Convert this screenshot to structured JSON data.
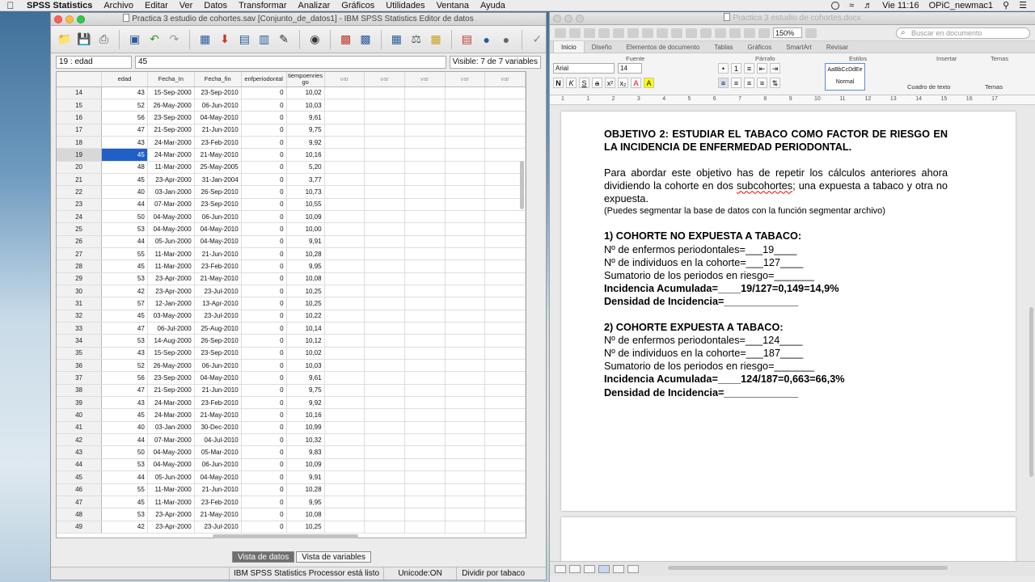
{
  "menubar": {
    "app": "SPSS Statistics",
    "items": [
      "Archivo",
      "Editar",
      "Ver",
      "Datos",
      "Transformar",
      "Analizar",
      "Gráficos",
      "Utilidades",
      "Ventana",
      "Ayuda"
    ],
    "clock": "Vie 11:16",
    "user": "OPiC_newmac1"
  },
  "spss": {
    "title": "Practica 3 estudio de cohortes.sav [Conjunto_de_datos1] - IBM SPSS Statistics Editor de datos",
    "cell_ref": "19 : edad",
    "cell_value": "45",
    "visible": "Visible: 7 de 7 variables",
    "columns": [
      "edad",
      "Fecha_In",
      "Fecha_fin",
      "enfperiodontal",
      "tiempoenries go",
      "var",
      "var",
      "var",
      "var",
      "var"
    ],
    "rows": [
      [
        "14",
        "43",
        "15-Sep-2000",
        "23-Sep-2010",
        "0",
        "10,02"
      ],
      [
        "15",
        "52",
        "26-May-2000",
        "06-Jun-2010",
        "0",
        "10,03"
      ],
      [
        "16",
        "56",
        "23-Sep-2000",
        "04-May-2010",
        "0",
        "9,61"
      ],
      [
        "17",
        "47",
        "21-Sep-2000",
        "21-Jun-2010",
        "0",
        "9,75"
      ],
      [
        "18",
        "43",
        "24-Mar-2000",
        "23-Feb-2010",
        "0",
        "9,92"
      ],
      [
        "19",
        "45",
        "24-Mar-2000",
        "21-May-2010",
        "0",
        "10,16"
      ],
      [
        "20",
        "48",
        "11-Mar-2000",
        "25-May-2005",
        "0",
        "5,20"
      ],
      [
        "21",
        "45",
        "23-Apr-2000",
        "31-Jan-2004",
        "0",
        "3,77"
      ],
      [
        "22",
        "40",
        "03-Jan-2000",
        "26-Sep-2010",
        "0",
        "10,73"
      ],
      [
        "23",
        "44",
        "07-Mar-2000",
        "23-Sep-2010",
        "0",
        "10,55"
      ],
      [
        "24",
        "50",
        "04-May-2000",
        "06-Jun-2010",
        "0",
        "10,09"
      ],
      [
        "25",
        "53",
        "04-May-2000",
        "04-May-2010",
        "0",
        "10,00"
      ],
      [
        "26",
        "44",
        "05-Jun-2000",
        "04-May-2010",
        "0",
        "9,91"
      ],
      [
        "27",
        "55",
        "11-Mar-2000",
        "21-Jun-2010",
        "0",
        "10,28"
      ],
      [
        "28",
        "45",
        "11-Mar-2000",
        "23-Feb-2010",
        "0",
        "9,95"
      ],
      [
        "29",
        "53",
        "23-Apr-2000",
        "21-May-2010",
        "0",
        "10,08"
      ],
      [
        "30",
        "42",
        "23-Apr-2000",
        "23-Jul-2010",
        "0",
        "10,25"
      ],
      [
        "31",
        "57",
        "12-Jan-2000",
        "13-Apr-2010",
        "0",
        "10,25"
      ],
      [
        "32",
        "45",
        "03-May-2000",
        "23-Jul-2010",
        "0",
        "10,22"
      ],
      [
        "33",
        "47",
        "06-Jul-2000",
        "25-Aug-2010",
        "0",
        "10,14"
      ],
      [
        "34",
        "53",
        "14-Aug-2000",
        "26-Sep-2010",
        "0",
        "10,12"
      ],
      [
        "35",
        "43",
        "15-Sep-2000",
        "23-Sep-2010",
        "0",
        "10,02"
      ],
      [
        "36",
        "52",
        "26-May-2000",
        "06-Jun-2010",
        "0",
        "10,03"
      ],
      [
        "37",
        "56",
        "23-Sep-2000",
        "04-May-2010",
        "0",
        "9,61"
      ],
      [
        "38",
        "47",
        "21-Sep-2000",
        "21-Jun-2010",
        "0",
        "9,75"
      ],
      [
        "39",
        "43",
        "24-Mar-2000",
        "23-Feb-2010",
        "0",
        "9,92"
      ],
      [
        "40",
        "45",
        "24-Mar-2000",
        "21-May-2010",
        "0",
        "10,16"
      ],
      [
        "41",
        "40",
        "03-Jan-2000",
        "30-Dec-2010",
        "0",
        "10,99"
      ],
      [
        "42",
        "44",
        "07-Mar-2000",
        "04-Jul-2010",
        "0",
        "10,32"
      ],
      [
        "43",
        "50",
        "04-May-2000",
        "05-Mar-2010",
        "0",
        "9,83"
      ],
      [
        "44",
        "53",
        "04-May-2000",
        "06-Jun-2010",
        "0",
        "10,09"
      ],
      [
        "45",
        "44",
        "05-Jun-2000",
        "04-May-2010",
        "0",
        "9,91"
      ],
      [
        "46",
        "55",
        "11-Mar-2000",
        "21-Jun-2010",
        "0",
        "10,28"
      ],
      [
        "47",
        "45",
        "11-Mar-2000",
        "23-Feb-2010",
        "0",
        "9,95"
      ],
      [
        "48",
        "53",
        "23-Apr-2000",
        "21-May-2010",
        "0",
        "10,08"
      ],
      [
        "49",
        "42",
        "23-Apr-2000",
        "23-Jul-2010",
        "0",
        "10,25"
      ]
    ],
    "selected_row": "19",
    "tab_data": "Vista de datos",
    "tab_vars": "Vista de variables",
    "status_processor": "IBM SPSS Statistics Processor está listo",
    "status_unicode": "Unicode:ON",
    "status_split": "Dividir por tabaco"
  },
  "word": {
    "title": "Practica 3 estudio de cohortes.docx",
    "zoom": "150%",
    "search_placeholder": "Buscar en documento",
    "ribbon_tabs": [
      "Inicio",
      "Diseño",
      "Elementos de documento",
      "Tablas",
      "Gráficos",
      "SmartArt",
      "Revisar"
    ],
    "group_labels": {
      "fuente": "Fuente",
      "parrafo": "Párrafo",
      "estilos": "Estilos",
      "insertar": "Insertar",
      "temas": "Temas"
    },
    "font_name": "Arial",
    "font_size": "14",
    "style_sample": "AaBbCcDdEe",
    "style_name": "Normal",
    "text_box_label": "Cuadro de texto",
    "themes_label": "Temas",
    "ruler_numbers": [
      "1",
      "1",
      "2",
      "3",
      "4",
      "5",
      "6",
      "7",
      "8",
      "9",
      "10",
      "11",
      "12",
      "13",
      "14",
      "15",
      "16",
      "17"
    ],
    "doc": {
      "heading": "OBJETIVO 2: ESTUDIAR EL TABACO COMO FACTOR DE RIESGO EN LA INCIDENCIA DE ENFERMEDAD PERIODONTAL.",
      "intro_a": "Para abordar este objetivo has de repetir los cálculos anteriores ahora dividiendo la cohorte en dos ",
      "intro_word": "subcohortes",
      "intro_b": "; una expuesta a tabaco y otra no expuesta.",
      "note": "(Puedes segmentar la base de datos con la función segmentar archivo)",
      "s1_title": "1) COHORTE NO EXPUESTA A TABACO:",
      "s1_l1": "Nº de enfermos periodontales=___19____",
      "s1_l2": "Nº de individuos en la cohorte=___127____",
      "s1_l3": "Sumatorio de los periodos en riesgo=_______",
      "s1_l4": "Incidencia Acumulada=____19/127=0,149=14,9%",
      "s1_l5": "Densidad de Incidencia=_____________",
      "s2_title": "2) COHORTE EXPUESTA A TABACO:",
      "s2_l1": "Nº de enfermos periodontales=___124____",
      "s2_l2": "Nº de individuos en la cohorte=___187____",
      "s2_l3": "Sumatorio de los periodos en riesgo=_______",
      "s2_l4": "Incidencia Acumulada=____124/187=0,663=66,3%",
      "s2_l5": "Densidad de Incidencia=_____________"
    }
  }
}
